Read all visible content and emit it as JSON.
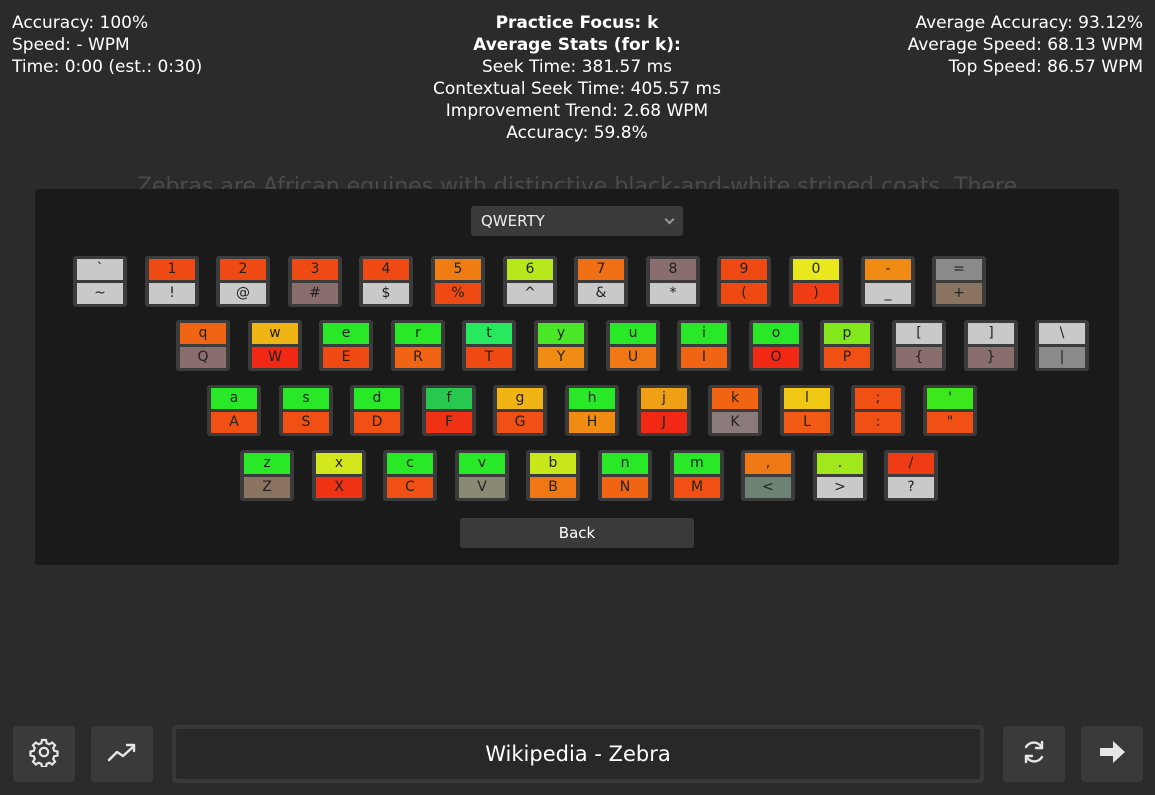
{
  "stats_left": {
    "accuracy": "Accuracy: 100%",
    "speed": "Speed: - WPM",
    "time": "Time: 0:00 (est.: 0:30)"
  },
  "stats_center": {
    "practice_focus": "Practice Focus: k",
    "average_stats": "Average Stats (for k):",
    "seek_time": "Seek Time: 381.57 ms",
    "contextual_seek_time": "Contextual Seek Time: 405.57 ms",
    "improvement_trend": "Improvement Trend: 2.68 WPM",
    "accuracy": "Accuracy: 59.8%"
  },
  "stats_right": {
    "average_accuracy": "Average Accuracy: 93.12%",
    "average_speed": "Average Speed: 68.13 WPM",
    "top_speed": "Top Speed: 86.57 WPM"
  },
  "layout_select": {
    "value": "QWERTY"
  },
  "passage": "Zebras are African equines with distinctive black-and-white striped coats. There are three living species: the Grévy's zebra, plains zebra, and the mountain zebra.",
  "keyboard": {
    "rows": [
      [
        {
          "lower": "`",
          "upper": "~",
          "lower_color": "#c9c9c9",
          "upper_color": "#c9c9c9"
        },
        {
          "lower": "1",
          "upper": "!",
          "lower_color": "#f04a14",
          "upper_color": "#c9c9c9"
        },
        {
          "lower": "2",
          "upper": "@",
          "lower_color": "#f04a14",
          "upper_color": "#c9c9c9"
        },
        {
          "lower": "3",
          "upper": "#",
          "lower_color": "#f04a14",
          "upper_color": "#8a6e6e"
        },
        {
          "lower": "4",
          "upper": "$",
          "lower_color": "#f04a14",
          "upper_color": "#c9c9c9"
        },
        {
          "lower": "5",
          "upper": "%",
          "lower_color": "#f07d14",
          "upper_color": "#f04a14"
        },
        {
          "lower": "6",
          "upper": "^",
          "lower_color": "#b6e81c",
          "upper_color": "#c9c9c9"
        },
        {
          "lower": "7",
          "upper": "&",
          "lower_color": "#f06e14",
          "upper_color": "#c9c9c9"
        },
        {
          "lower": "8",
          "upper": "*",
          "lower_color": "#8a6e6e",
          "upper_color": "#c9c9c9"
        },
        {
          "lower": "9",
          "upper": "(",
          "lower_color": "#f04a14",
          "upper_color": "#f04a14"
        },
        {
          "lower": "0",
          "upper": ")",
          "lower_color": "#e8e81c",
          "upper_color": "#f03c14"
        },
        {
          "lower": "-",
          "upper": "_",
          "lower_color": "#f08c14",
          "upper_color": "#c9c9c9"
        },
        {
          "lower": "=",
          "upper": "+",
          "lower_color": "#8a8a8a",
          "upper_color": "#8a7460"
        }
      ],
      [
        {
          "lower": "q",
          "upper": "Q",
          "lower_color": "#f06414",
          "upper_color": "#8a6e6e"
        },
        {
          "lower": "w",
          "upper": "W",
          "lower_color": "#f0b414",
          "upper_color": "#f02814"
        },
        {
          "lower": "e",
          "upper": "E",
          "lower_color": "#28e828",
          "upper_color": "#f04a14"
        },
        {
          "lower": "r",
          "upper": "R",
          "lower_color": "#28e828",
          "upper_color": "#f06414"
        },
        {
          "lower": "t",
          "upper": "T",
          "lower_color": "#28e860",
          "upper_color": "#f04a14"
        },
        {
          "lower": "y",
          "upper": "Y",
          "lower_color": "#4ae828",
          "upper_color": "#f08c14"
        },
        {
          "lower": "u",
          "upper": "U",
          "lower_color": "#28e828",
          "upper_color": "#f07814"
        },
        {
          "lower": "i",
          "upper": "I",
          "lower_color": "#28e828",
          "upper_color": "#f06414"
        },
        {
          "lower": "o",
          "upper": "O",
          "lower_color": "#28e828",
          "upper_color": "#f02814"
        },
        {
          "lower": "p",
          "upper": "P",
          "lower_color": "#82e81c",
          "upper_color": "#f05014"
        },
        {
          "lower": "[",
          "upper": "{",
          "lower_color": "#c9c9c9",
          "upper_color": "#8a6e6e"
        },
        {
          "lower": "]",
          "upper": "}",
          "lower_color": "#c9c9c9",
          "upper_color": "#8a6e6e"
        },
        {
          "lower": "\\",
          "upper": "|",
          "lower_color": "#c9c9c9",
          "upper_color": "#8a8a8a"
        }
      ],
      [
        {
          "lower": "a",
          "upper": "A",
          "lower_color": "#28e828",
          "upper_color": "#f05014"
        },
        {
          "lower": "s",
          "upper": "S",
          "lower_color": "#28e828",
          "upper_color": "#f05014"
        },
        {
          "lower": "d",
          "upper": "D",
          "lower_color": "#28e828",
          "upper_color": "#f05014"
        },
        {
          "lower": "f",
          "upper": "F",
          "lower_color": "#28c850",
          "upper_color": "#f03214"
        },
        {
          "lower": "g",
          "upper": "G",
          "lower_color": "#f0b414",
          "upper_color": "#f05014"
        },
        {
          "lower": "h",
          "upper": "H",
          "lower_color": "#28e828",
          "upper_color": "#f08c14"
        },
        {
          "lower": "j",
          "upper": "J",
          "lower_color": "#f0a014",
          "upper_color": "#f02814"
        },
        {
          "lower": "k",
          "upper": "K",
          "lower_color": "#f06414",
          "upper_color": "#8a7a7a"
        },
        {
          "lower": "l",
          "upper": "L",
          "lower_color": "#f0c814",
          "upper_color": "#f05a14"
        },
        {
          "lower": ";",
          "upper": ":",
          "lower_color": "#f05014",
          "upper_color": "#f05014"
        },
        {
          "lower": "'",
          "upper": "\"",
          "lower_color": "#3ce81c",
          "upper_color": "#f05014"
        }
      ],
      [
        {
          "lower": "z",
          "upper": "Z",
          "lower_color": "#28e828",
          "upper_color": "#8a7460"
        },
        {
          "lower": "x",
          "upper": "X",
          "lower_color": "#d2e81c",
          "upper_color": "#f03214"
        },
        {
          "lower": "c",
          "upper": "C",
          "lower_color": "#28e828",
          "upper_color": "#f05014"
        },
        {
          "lower": "v",
          "upper": "V",
          "lower_color": "#28e828",
          "upper_color": "#8a8a74"
        },
        {
          "lower": "b",
          "upper": "B",
          "lower_color": "#c8e81c",
          "upper_color": "#f07814"
        },
        {
          "lower": "n",
          "upper": "N",
          "lower_color": "#28e828",
          "upper_color": "#f06414"
        },
        {
          "lower": "m",
          "upper": "M",
          "lower_color": "#28e828",
          "upper_color": "#f05014"
        },
        {
          "lower": ",",
          "upper": "<",
          "lower_color": "#f07814",
          "upper_color": "#6e8274"
        },
        {
          "lower": ".",
          "upper": ">",
          "lower_color": "#a0e81c",
          "upper_color": "#c9c9c9"
        },
        {
          "lower": "/",
          "upper": "?",
          "lower_color": "#f03c14",
          "upper_color": "#c9c9c9"
        }
      ]
    ]
  },
  "back_button": {
    "label": "Back"
  },
  "source_title": "Wikipedia - Zebra",
  "icons": {
    "settings": "gear-icon",
    "stats": "trend-chart-icon",
    "refresh": "refresh-icon",
    "next": "arrow-right-icon"
  }
}
